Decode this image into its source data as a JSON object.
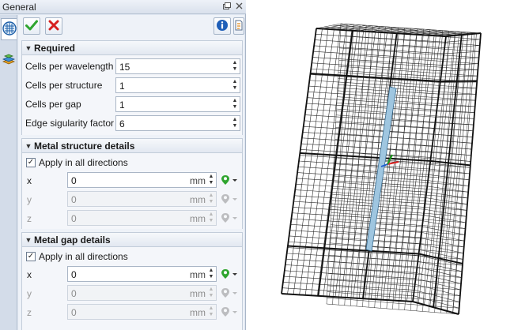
{
  "panel": {
    "title": "General",
    "title_buttons": [
      "restore-icon",
      "close-icon"
    ]
  },
  "side_tabs": [
    {
      "name": "mesh-settings-tab",
      "icon": "mesh-icon",
      "active": true
    },
    {
      "name": "layers-tab",
      "icon": "layers-icon",
      "active": false
    }
  ],
  "toolbar": {
    "ok_icon": "check-icon",
    "cancel_icon": "cross-icon",
    "info_icon": "info-icon",
    "help_icon": "help-icon"
  },
  "required": {
    "title": "Required",
    "fields": [
      {
        "label": "Cells per wavelength",
        "value": "15"
      },
      {
        "label": "Cells per structure",
        "value": "1"
      },
      {
        "label": "Cells per gap",
        "value": "1"
      },
      {
        "label": "Edge sigularity factor",
        "value": "6"
      }
    ]
  },
  "metal_structure": {
    "title": "Metal structure details",
    "apply_label": "Apply in all directions",
    "apply_checked": true,
    "axes": [
      {
        "label": "x",
        "value": "0",
        "unit": "mm",
        "enabled": true
      },
      {
        "label": "y",
        "value": "0",
        "unit": "mm",
        "enabled": false
      },
      {
        "label": "z",
        "value": "0",
        "unit": "mm",
        "enabled": false
      }
    ]
  },
  "metal_gap": {
    "title": "Metal gap details",
    "apply_label": "Apply in all directions",
    "apply_checked": true,
    "axes": [
      {
        "label": "x",
        "value": "0",
        "unit": "mm",
        "enabled": true
      },
      {
        "label": "y",
        "value": "0",
        "unit": "mm",
        "enabled": false
      },
      {
        "label": "z",
        "value": "0",
        "unit": "mm",
        "enabled": false
      }
    ]
  },
  "colors": {
    "accent_green": "#2fa52f",
    "cancel_red": "#d62020",
    "info_blue": "#1f5fb8",
    "mesh_line": "#2b2b2b",
    "rod": "#9fc6e0"
  }
}
